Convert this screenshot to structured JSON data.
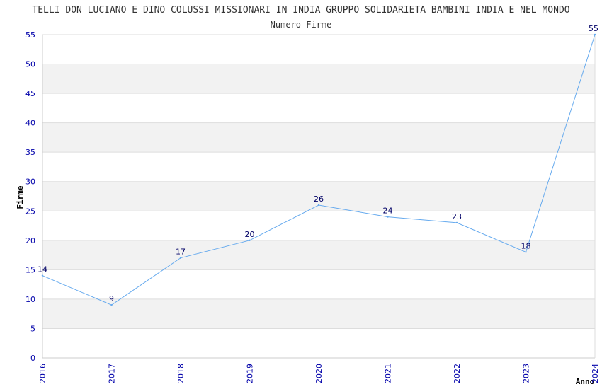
{
  "chart_data": {
    "type": "line",
    "title": "TELLI DON LUCIANO E DINO COLUSSI MISSIONARI IN INDIA GRUPPO SOLIDARIETA BAMBINI INDIA E NEL MONDO",
    "subtitle": "Numero Firme",
    "xlabel": "Anno",
    "ylabel": "Firme",
    "x": [
      "2016",
      "2017",
      "2018",
      "2019",
      "2020",
      "2021",
      "2022",
      "2023",
      "2024"
    ],
    "series": [
      {
        "values": [
          14,
          9,
          17,
          20,
          26,
          24,
          23,
          18,
          55
        ]
      }
    ],
    "yticks": [
      "0",
      "5",
      "10",
      "15",
      "20",
      "25",
      "30",
      "35",
      "40",
      "45",
      "50",
      "55"
    ],
    "ylim": [
      0,
      55
    ],
    "grid": true,
    "colors": {
      "line": "#66aaee",
      "band": "#f2f2f2",
      "grid": "#dddddd",
      "axis": "#cccccc",
      "tick_text": "#0000aa",
      "data_label": "#000066"
    }
  }
}
